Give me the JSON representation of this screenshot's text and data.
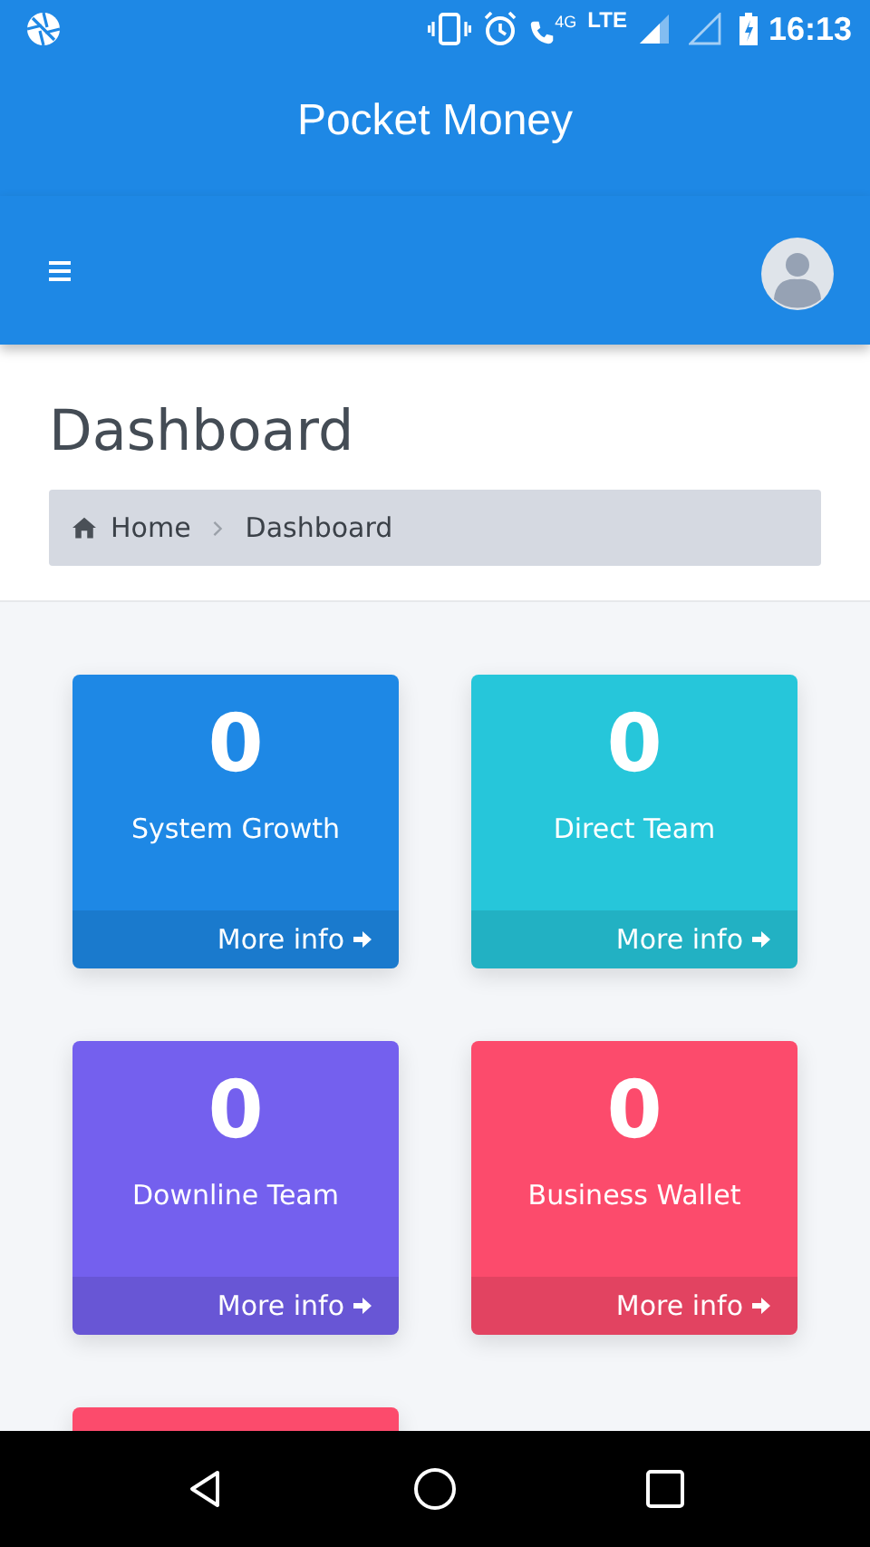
{
  "status_bar": {
    "network_badge": "4G",
    "network_type": "LTE",
    "time": "16:13"
  },
  "app_title": "Pocket Money",
  "page_title": "Dashboard",
  "breadcrumb": [
    {
      "label": "Home",
      "kind": "home"
    },
    {
      "label": "Dashboard",
      "kind": "current"
    }
  ],
  "cards": [
    {
      "value": "0",
      "label": "System Growth",
      "link": "More info",
      "color": "#1e88e5"
    },
    {
      "value": "0",
      "label": "Direct Team",
      "link": "More info",
      "color": "#26c6da"
    },
    {
      "value": "0",
      "label": "Downline Team",
      "link": "More info",
      "color": "#7460ee"
    },
    {
      "value": "0",
      "label": "Business Wallet",
      "link": "More info",
      "color": "#fc4b6c"
    },
    {
      "color": "#fc4b6c"
    }
  ]
}
